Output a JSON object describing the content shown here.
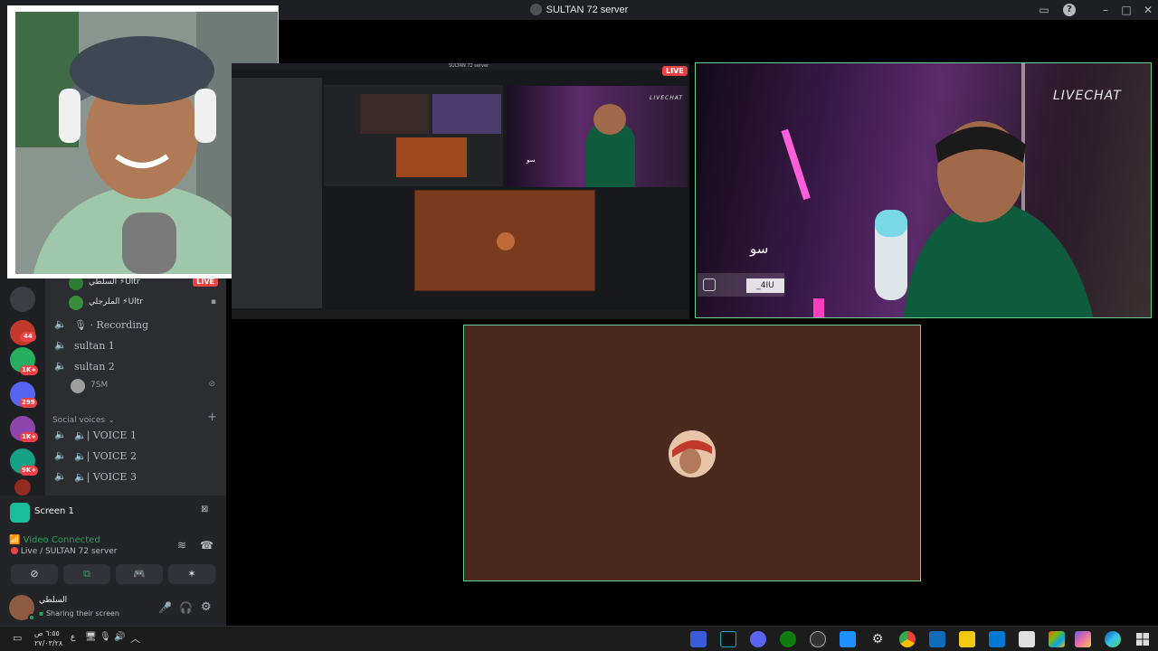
{
  "window": {
    "title": "SULTAN 72 server"
  },
  "server_rail": {
    "badges": [
      "44",
      "1K+",
      "299",
      "1K+",
      "9K+"
    ]
  },
  "channels": {
    "live_users": [
      {
        "name": "السلطي ⚡Ultr",
        "badge": "LIVE"
      },
      {
        "name": "الملرجلي ⚡Ultr"
      }
    ],
    "voice_channels": [
      {
        "label": "Recording",
        "prefix": "🎙 · "
      },
      {
        "label": "sultan 1"
      },
      {
        "label": "sultan 2"
      }
    ],
    "sultan2_user": "7SM",
    "category_label": "Social voices",
    "social_channels": [
      {
        "label": "🔈| VOICE 1"
      },
      {
        "label": "🔈| VOICE 2"
      },
      {
        "label": "🔈| VOICE 3"
      }
    ]
  },
  "rtc": {
    "screen_share_label": "Screen 1",
    "status": "Video Connected",
    "location": "Live / SULTAN 72 server",
    "status_color": "#23a55a"
  },
  "user_panel": {
    "name": "السلطي",
    "status": "Sharing their screen"
  },
  "stream_tiles": {
    "nested_window_title": "SULTAN 72 server",
    "live_badge": "LIVE",
    "webcam_watermark": "LIVECHAT",
    "webcam_caption": "سو",
    "webcam_tag": "_4IU",
    "small_watermark": "LIVECHAT",
    "small_caption": "سو"
  },
  "taskbar": {
    "clock_time": "٦:٥٥ ص",
    "clock_date": "٢٧/٠٣/٢٨",
    "lang": "ع"
  },
  "colors": {
    "accent_green": "#6fcf97",
    "live_red": "#ed4245",
    "stream_brown": "#4a2a1e"
  }
}
